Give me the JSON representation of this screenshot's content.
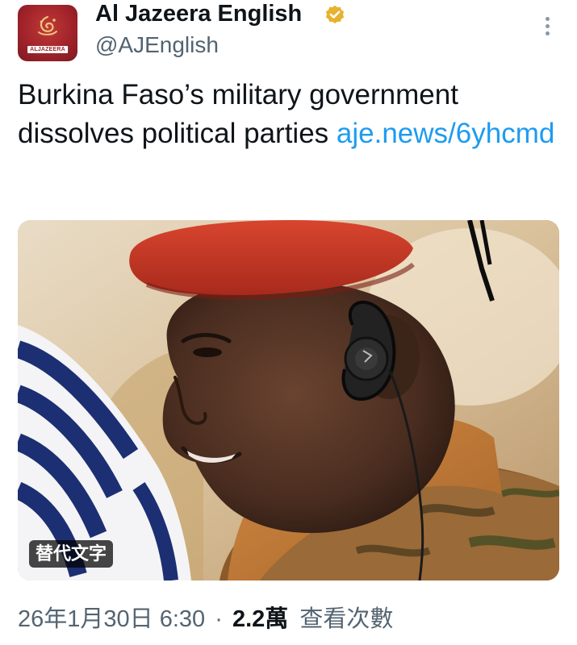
{
  "author": {
    "display_name": "Al Jazeera English",
    "handle": "@AJEnglish",
    "avatar_wordmark": "ALJAZEERA",
    "verified_badge_color": "#e7b22f",
    "avatar_color": "#a1232a"
  },
  "tweet": {
    "text": "Burkina Faso’s military government dissolves political parties ",
    "link": "aje.news/6yhcmd",
    "link_color": "#1d9bf0"
  },
  "media": {
    "alt_badge_label": "替代文字"
  },
  "meta": {
    "date": "26年1月30日",
    "time": "6:30",
    "separator": "·",
    "views_count": "2.2萬",
    "views_label": "查看次數"
  },
  "icons": {
    "more_menu": "more-vertical-icon",
    "verified": "verified-badge-icon",
    "avatar_logo": "aljazeera-logo-icon"
  }
}
